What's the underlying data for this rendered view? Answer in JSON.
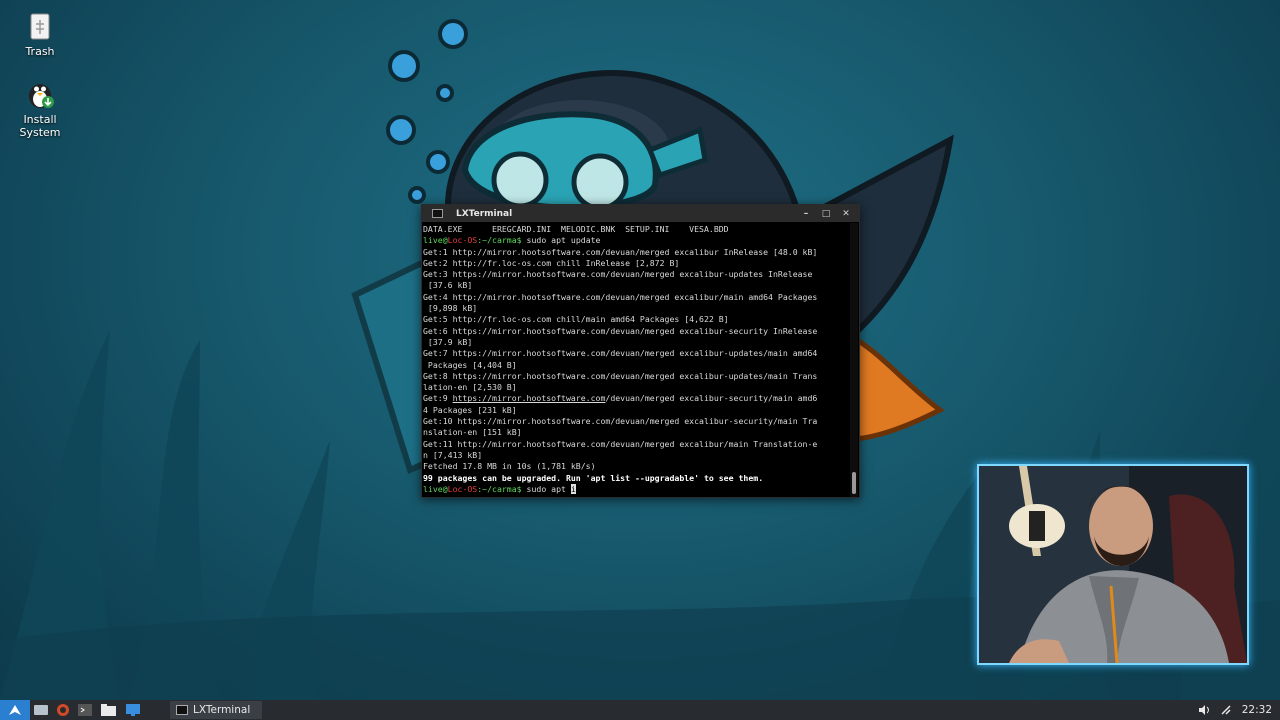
{
  "desktop": {
    "icons": [
      {
        "label": "Trash",
        "icon": "trash-icon"
      },
      {
        "label": "Install\nSystem",
        "icon": "penguin-install-icon"
      }
    ]
  },
  "terminal": {
    "title": "LXTerminal",
    "controls": {
      "minimize": "–",
      "maximize": "□",
      "close": "✕"
    },
    "lines": [
      {
        "t": "DATA.EXE      EREGCARD.INI  MELODIC.BNK  SETUP.INI    VESA.BDD"
      },
      {
        "user": "live",
        "host": "Loc-OS",
        "path": ":~/carma$",
        "cmd": " sudo apt update"
      },
      {
        "t": "Get:1 http://mirror.hootsoftware.com/devuan/merged excalibur InRelease [48.0 kB]"
      },
      {
        "t": "Get:2 http://fr.loc-os.com chill InRelease [2,872 B]"
      },
      {
        "t": "Get:3 https://mirror.hootsoftware.com/devuan/merged excalibur-updates InRelease"
      },
      {
        "t": " [37.6 kB]"
      },
      {
        "t": "Get:4 http://mirror.hootsoftware.com/devuan/merged excalibur/main amd64 Packages"
      },
      {
        "t": " [9,898 kB]"
      },
      {
        "t": "Get:5 http://fr.loc-os.com chill/main amd64 Packages [4,622 B]"
      },
      {
        "t": "Get:6 https://mirror.hootsoftware.com/devuan/merged excalibur-security InRelease"
      },
      {
        "t": " [37.9 kB]"
      },
      {
        "t": "Get:7 https://mirror.hootsoftware.com/devuan/merged excalibur-updates/main amd64"
      },
      {
        "t": " Packages [4,404 B]"
      },
      {
        "t": "Get:8 https://mirror.hootsoftware.com/devuan/merged excalibur-updates/main Trans"
      },
      {
        "t": "lation-en [2,530 B]"
      },
      {
        "pre": "Get:9 ",
        "link": "https://mirror.hootsoftware.com",
        "post": "/devuan/merged excalibur-security/main amd6"
      },
      {
        "t": "4 Packages [231 kB]"
      },
      {
        "t": "Get:10 https://mirror.hootsoftware.com/devuan/merged excalibur-security/main Tra"
      },
      {
        "t": "nslation-en [151 kB]"
      },
      {
        "t": "Get:11 http://mirror.hootsoftware.com/devuan/merged excalibur/main Translation-e"
      },
      {
        "t": "n [7,413 kB]"
      },
      {
        "t": "Fetched 17.8 MB in 10s (1,781 kB/s)"
      },
      {
        "b": "99 packages can be upgraded. Run 'apt list --upgradable' to see them."
      },
      {
        "user": "live",
        "host": "Loc-OS",
        "path": ":~/carma$",
        "cmd": " sudo apt ",
        "cursor": "i"
      }
    ]
  },
  "taskbar": {
    "launchers": [
      "start-menu-icon",
      "file-manager-icon",
      "browser-icon",
      "terminal-icon",
      "folder-icon",
      "screen-icon"
    ],
    "task_label": "LXTerminal",
    "clock": "22:32"
  },
  "colors": {
    "prompt_user": "#5fd75f",
    "prompt_host": "#e04040",
    "taskbar": "#282c31",
    "webcam_border": "#7fd8ff"
  }
}
